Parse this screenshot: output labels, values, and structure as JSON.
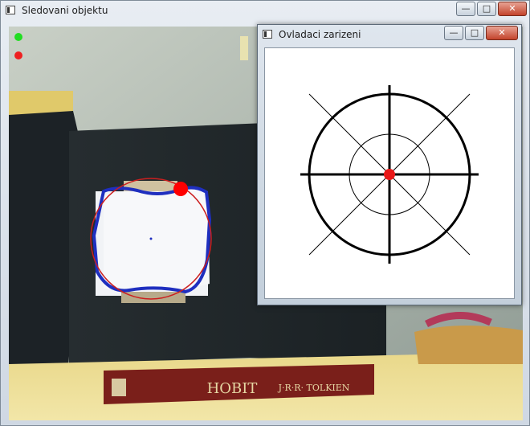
{
  "main_window": {
    "title": "Sledovani objektu",
    "controls": {
      "minimize": "—",
      "maximize": "□",
      "close": "✕"
    }
  },
  "control_window": {
    "title": "Ovladaci zarizeni",
    "controls": {
      "minimize": "—",
      "maximize": "□",
      "close": "✕"
    }
  },
  "book": {
    "title": "HOBIT",
    "author": "J·R·R· TOLKIEN"
  },
  "colors": {
    "indicator_green": "#22dd22",
    "indicator_red": "#ee2020",
    "tracking_contour": "#1f2fbf",
    "tracking_circle": "#cc1f1f",
    "target_marker": "#ff0000",
    "crosshair_center": "#e81818"
  }
}
